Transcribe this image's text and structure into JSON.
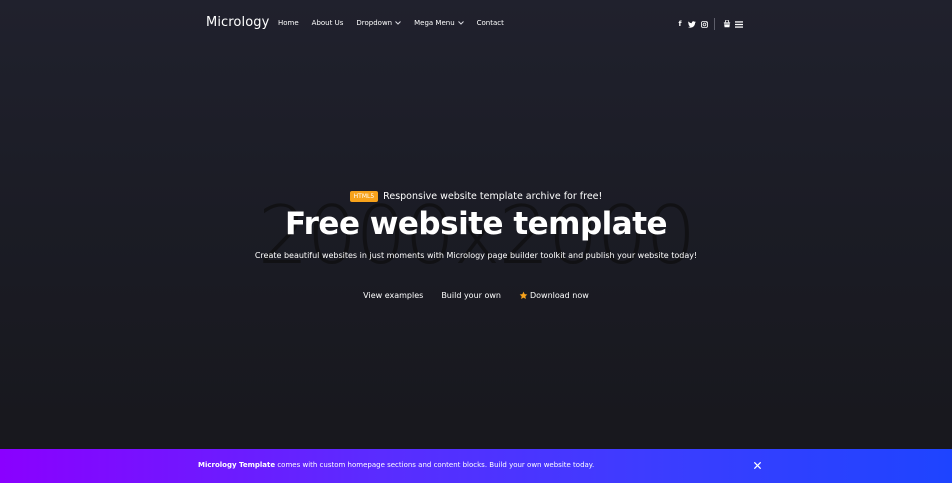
{
  "navbar": {
    "brand": "Micrology",
    "links": [
      {
        "label": "Home"
      },
      {
        "label": "About Us"
      },
      {
        "label": "Dropdown"
      },
      {
        "label": "Mega Menu"
      },
      {
        "label": "Contact"
      }
    ],
    "social": {
      "facebook_glyph": "f",
      "twitter_icon": "twitter-icon",
      "instagram_icon": "instagram-icon"
    },
    "tools": [
      "cart-icon",
      "menu-icon"
    ]
  },
  "hero": {
    "background_text": "2000x2000",
    "badge": "HTML5",
    "tagline": "Responsive website template archive for free!",
    "headline": "Free website template",
    "subline": "Create beautiful websites in just moments with Micrology page builder toolkit and publish your website today!",
    "cta": {
      "examples": "View examples",
      "build": "Build your own",
      "download": "Download now"
    }
  },
  "banner": {
    "brand": "Micrology Template",
    "message": " comes with custom homepage sections and content blocks. Build your own website today.",
    "close_icon": "close-icon"
  },
  "colors": {
    "badge": "#f7a21b",
    "star": "#f7a21b",
    "banner_start": "#8a00ff",
    "banner_end": "#1e44ff",
    "background": "#1b1c25"
  }
}
